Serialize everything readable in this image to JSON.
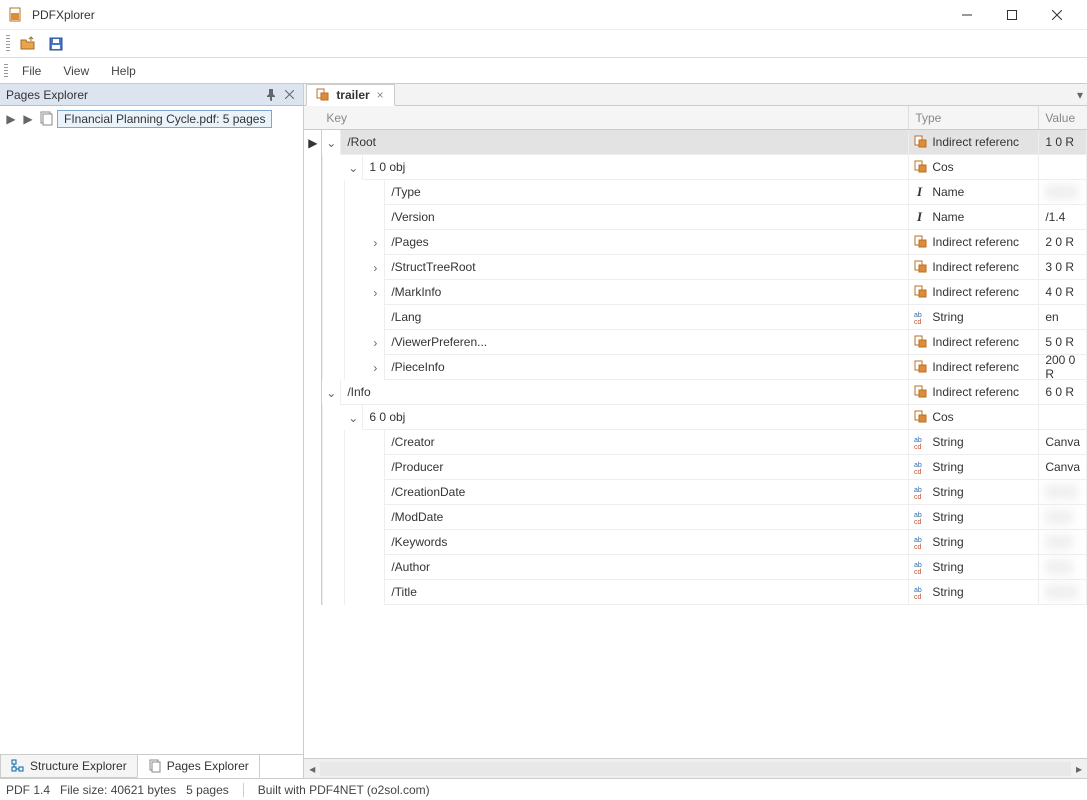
{
  "window": {
    "title": "PDFXplorer"
  },
  "menubar": {
    "file": "File",
    "view": "View",
    "help": "Help"
  },
  "left_panel": {
    "title": "Pages Explorer",
    "file_entry": "FInancial Planning Cycle.pdf: 5 pages",
    "tabs": {
      "structure": "Structure Explorer",
      "pages": "Pages Explorer"
    }
  },
  "right_panel": {
    "tab_label": "trailer",
    "columns": {
      "key": "Key",
      "type": "Type",
      "value": "Value"
    },
    "type_labels": {
      "indirect": "Indirect referenc",
      "cos": "Cos",
      "name": "Name",
      "string": "String"
    },
    "rows": {
      "root": {
        "key": "/Root",
        "type": "indirect",
        "value": "1 0 R"
      },
      "root_obj": {
        "key": "1 0 obj",
        "type": "cos",
        "value": ""
      },
      "root_type": {
        "key": "/Type",
        "type": "name",
        "value": ""
      },
      "root_version": {
        "key": "/Version",
        "type": "name",
        "value": "/1.4"
      },
      "root_pages": {
        "key": "/Pages",
        "type": "indirect",
        "value": "2 0 R"
      },
      "root_struct": {
        "key": "/StructTreeRoot",
        "type": "indirect",
        "value": "3 0 R"
      },
      "root_mark": {
        "key": "/MarkInfo",
        "type": "indirect",
        "value": "4 0 R"
      },
      "root_lang": {
        "key": "/Lang",
        "type": "string",
        "value": "en"
      },
      "root_viewer": {
        "key": "/ViewerPreferen...",
        "type": "indirect",
        "value": "5 0 R"
      },
      "root_piece": {
        "key": "/PieceInfo",
        "type": "indirect",
        "value": "200 0 R"
      },
      "info": {
        "key": "/Info",
        "type": "indirect",
        "value": "6 0 R"
      },
      "info_obj": {
        "key": "6 0 obj",
        "type": "cos",
        "value": ""
      },
      "info_creator": {
        "key": "/Creator",
        "type": "string",
        "value": "Canva"
      },
      "info_producer": {
        "key": "/Producer",
        "type": "string",
        "value": "Canva"
      },
      "info_creation": {
        "key": "/CreationDate",
        "type": "string",
        "value": ""
      },
      "info_mod": {
        "key": "/ModDate",
        "type": "string",
        "value": ""
      },
      "info_keywords": {
        "key": "/Keywords",
        "type": "string",
        "value": ""
      },
      "info_author": {
        "key": "/Author",
        "type": "string",
        "value": ""
      },
      "info_title": {
        "key": "/Title",
        "type": "string",
        "value": ""
      }
    }
  },
  "status_bar": {
    "pdf_version": "PDF 1.4",
    "file_size": "File size: 40621 bytes",
    "pages": "5 pages",
    "built_with": "Built with PDF4NET (o2sol.com)"
  }
}
